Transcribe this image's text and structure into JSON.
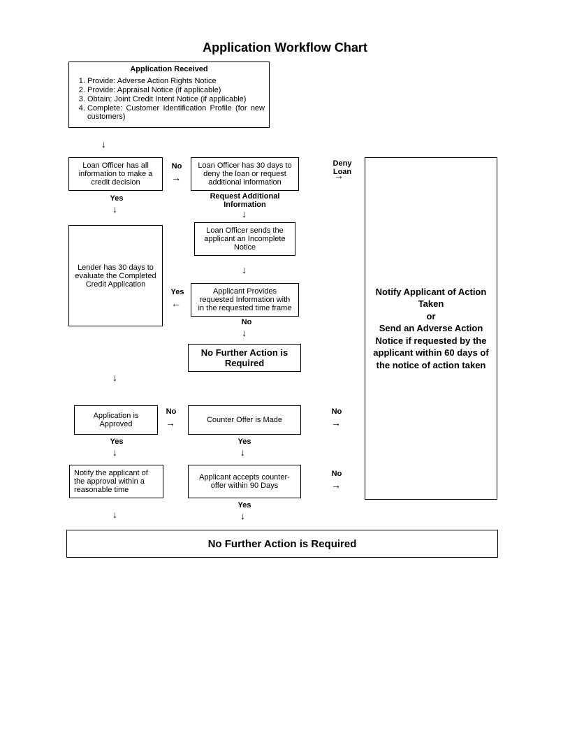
{
  "title": "Application Workflow Chart",
  "appReceived": {
    "header": "Application Received",
    "items": [
      "Provide: Adverse Action Rights Notice",
      "Provide: Appraisal Notice (if applicable)",
      "Obtain: Joint Credit Intent Notice (if applicable)",
      "Complete: Customer Identification Profile (for new customers)"
    ]
  },
  "boxes": {
    "loanOfficerAll": "Loan Officer has all information to make a credit decision",
    "loanOfficer30": "Loan Officer has 30 days to deny the loan or request additional information",
    "requestAddl": "Request Additional Information",
    "lender30": "Lender has 30 days to evaluate the Completed Credit Application",
    "incompleteNotice": "Loan Officer sends the applicant an Incomplete Notice",
    "applicantProvides": "Applicant Provides requested Information with in the requested time frame",
    "noFurther1": "No Further Action is Required",
    "appApproved": "Application is Approved",
    "counterOffer": "Counter Offer is Made",
    "notifyApplicant": "Notify the applicant of the approval within a reasonable time",
    "applicantAccepts": "Applicant accepts counter-offer within 90 Days",
    "noFurther2": "No Further Action is Required",
    "bigNotify": "Notify Applicant of Action Taken\nor\nSend an Adverse Action Notice if requested by the applicant within 60 days of the notice of action taken"
  },
  "labels": {
    "yes": "Yes",
    "no": "No",
    "denyLoan": "Deny Loan"
  }
}
